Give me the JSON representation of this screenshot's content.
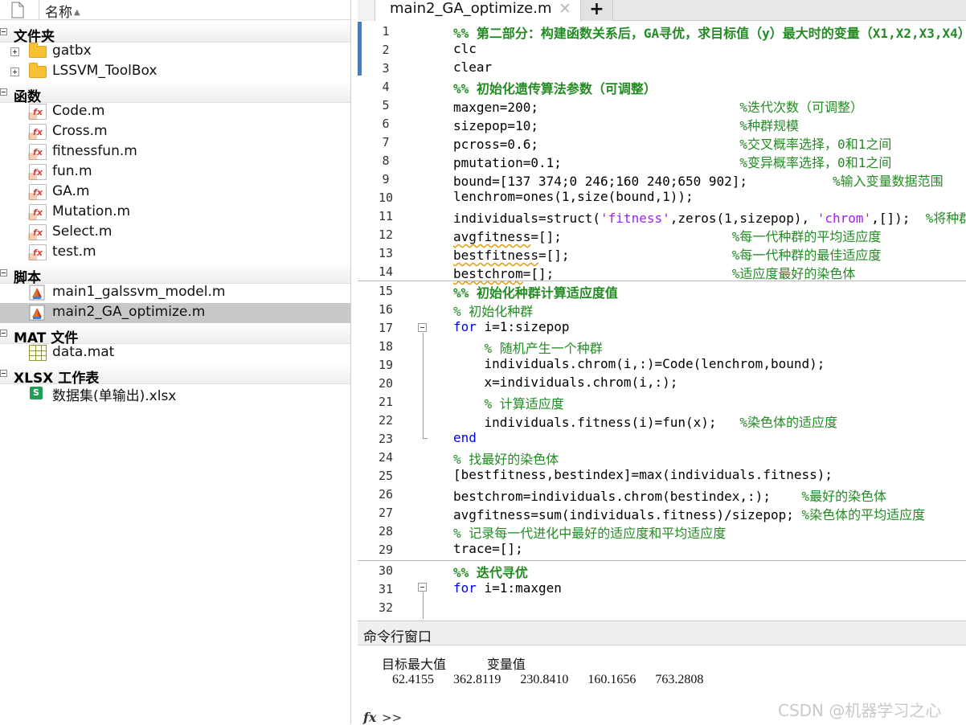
{
  "browser": {
    "column_header": "名称",
    "sections": [
      {
        "label": "文件夹"
      },
      {
        "label": "函数"
      },
      {
        "label": "脚本"
      },
      {
        "label": "MAT 文件"
      },
      {
        "label": "XLSX 工作表"
      }
    ],
    "folders": [
      "gatbx",
      "LSSVM_ToolBox"
    ],
    "functions": [
      "Code.m",
      "Cross.m",
      "fitnessfun.m",
      "fun.m",
      "GA.m",
      "Mutation.m",
      "Select.m",
      "test.m"
    ],
    "scripts": [
      "main1_galssvm_model.m",
      "main2_GA_optimize.m"
    ],
    "mat_files": [
      "data.mat"
    ],
    "xlsx_files": [
      "数据集(单输出).xlsx"
    ],
    "xlsx_icon_letter": "S"
  },
  "editor": {
    "tab_label": "main2_GA_optimize.m",
    "tab_close": "✕",
    "add_tab": "+",
    "line_numbers": [
      "1",
      "2",
      "3",
      "4",
      "5",
      "6",
      "7",
      "8",
      "9",
      "10",
      "11",
      "12",
      "13",
      "14",
      "15",
      "16",
      "17",
      "18",
      "19",
      "20",
      "21",
      "22",
      "23",
      "24",
      "25",
      "26",
      "27",
      "28",
      "29",
      "30",
      "31",
      "32"
    ]
  },
  "command_window": {
    "title": "命令行窗口",
    "header": "目标最大值          变量值",
    "values": "62.4155   362.8119   230.8410   160.1656   763.2808",
    "fx": "fx",
    "prompt": ">>"
  },
  "watermark": "CSDN @机器学习之心"
}
